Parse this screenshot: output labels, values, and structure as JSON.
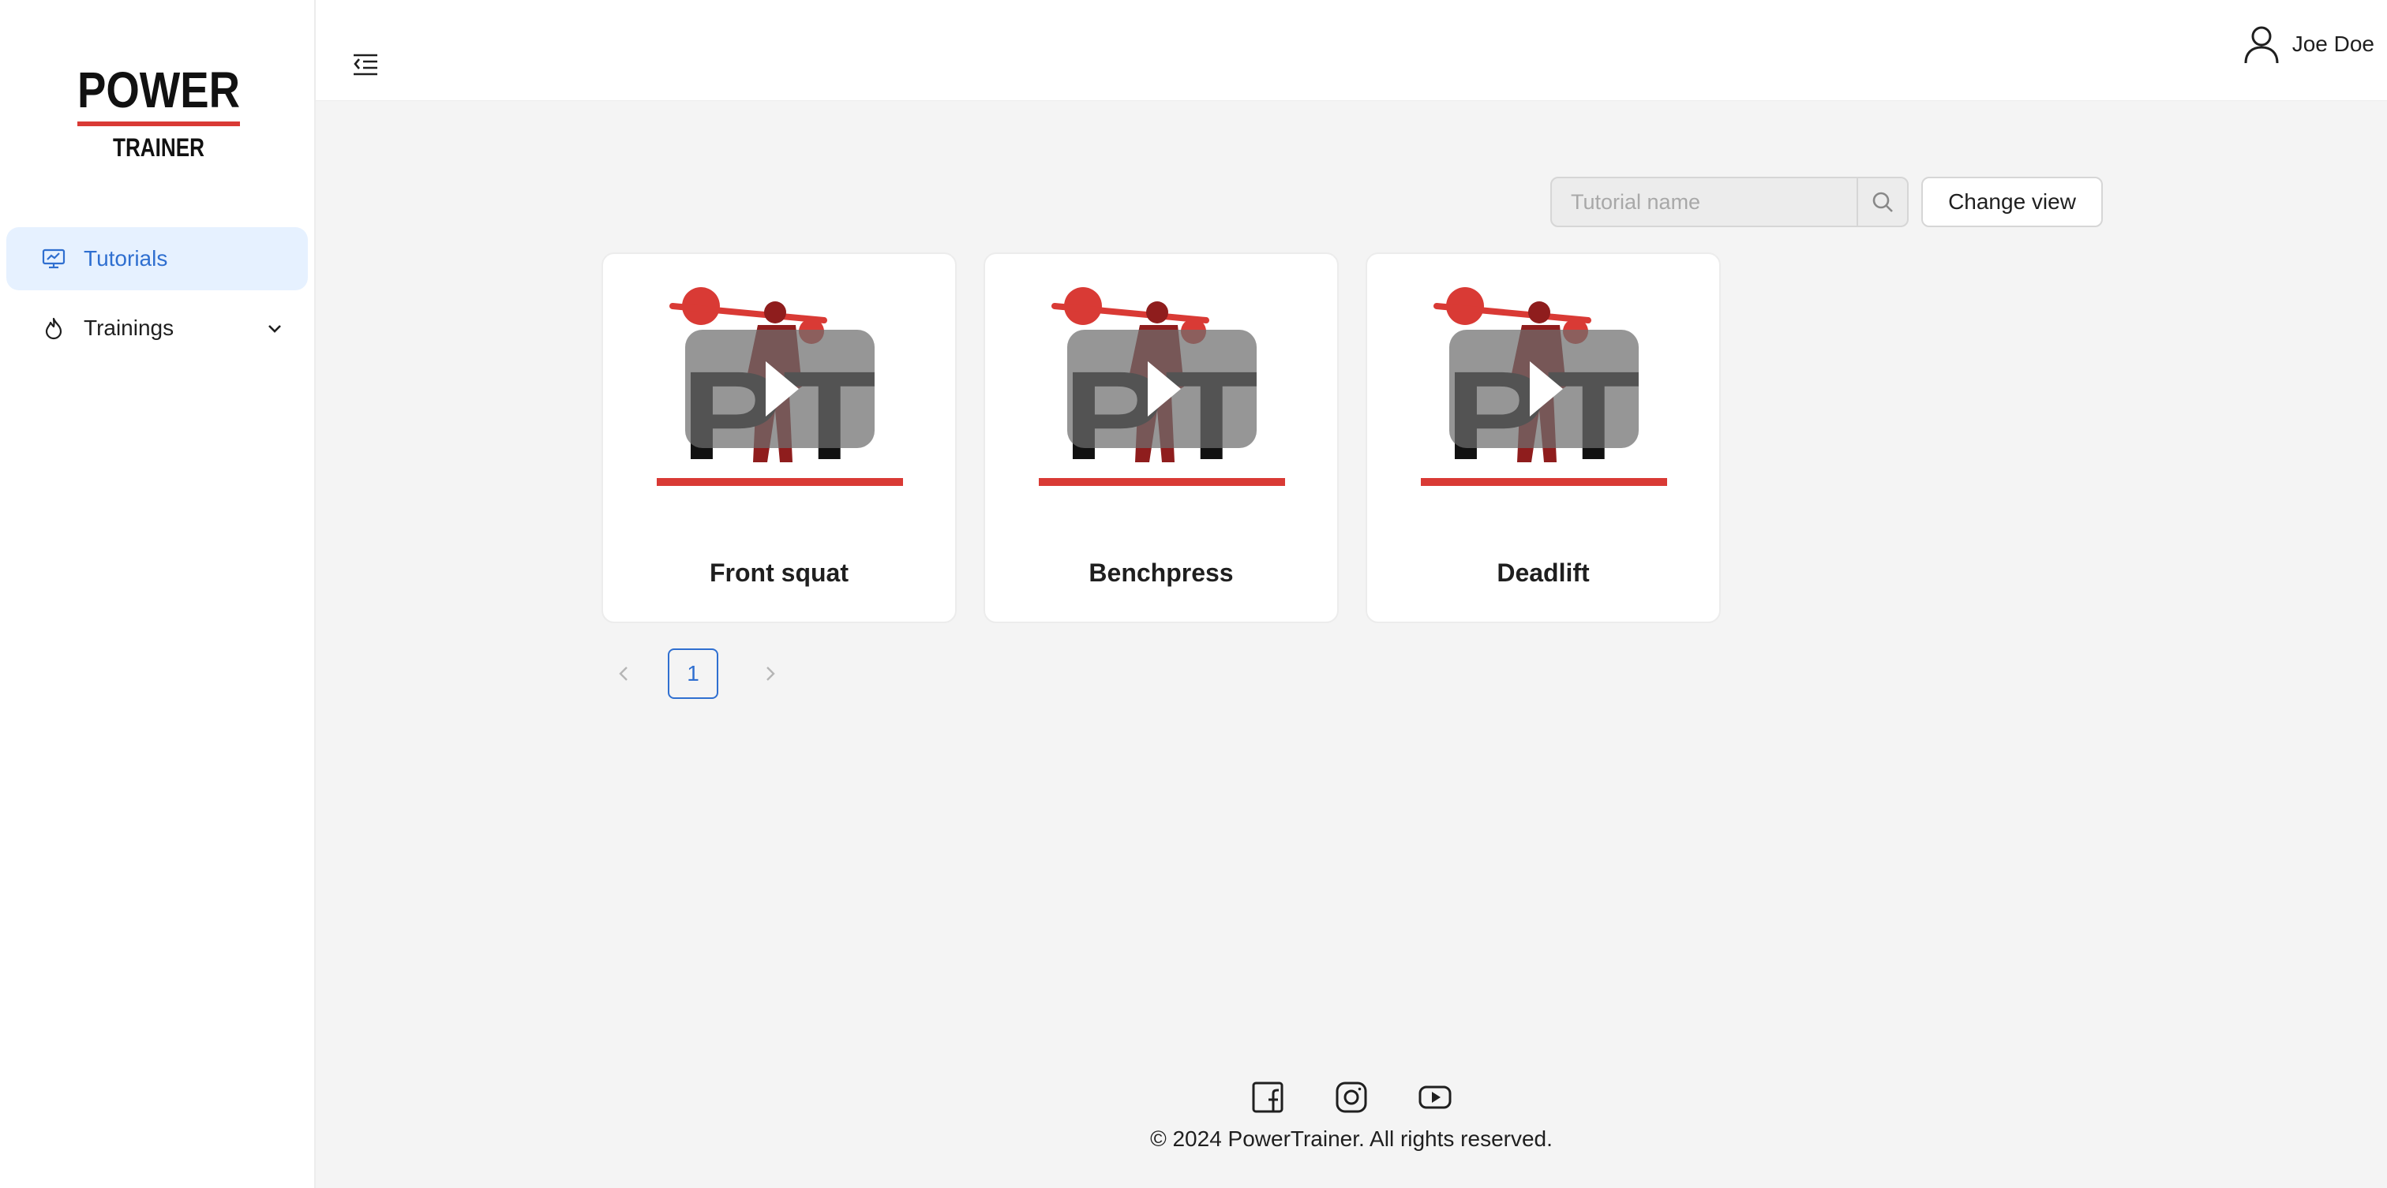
{
  "brand": {
    "line1": "POWER",
    "line2": "TRAINER",
    "accent": "#d93a35"
  },
  "sidebar": {
    "items": [
      {
        "label": "Tutorials",
        "icon": "presentation-chart-icon",
        "active": true
      },
      {
        "label": "Trainings",
        "icon": "flame-icon",
        "active": false,
        "expandable": true
      }
    ]
  },
  "header": {
    "user_name": "Joe Doe",
    "user_icon": "user-icon",
    "menu_icon": "menu-fold-icon"
  },
  "toolbar": {
    "search_placeholder": "Tutorial name",
    "change_view_label": "Change view"
  },
  "cards": [
    {
      "title": "Front squat",
      "thumbnail_text": "PT"
    },
    {
      "title": "Benchpress",
      "thumbnail_text": "PT"
    },
    {
      "title": "Deadlift",
      "thumbnail_text": "PT"
    }
  ],
  "pagination": {
    "current_page": "1",
    "prev_icon": "chevron-left-icon",
    "next_icon": "chevron-right-icon"
  },
  "footer": {
    "socials": [
      "facebook-icon",
      "instagram-icon",
      "youtube-icon"
    ],
    "copyright": "© 2024 PowerTrainer. All rights reserved."
  },
  "colors": {
    "primary": "#2f6fd0",
    "active_bg": "#e6f1ff",
    "brand_red": "#d93a35"
  }
}
